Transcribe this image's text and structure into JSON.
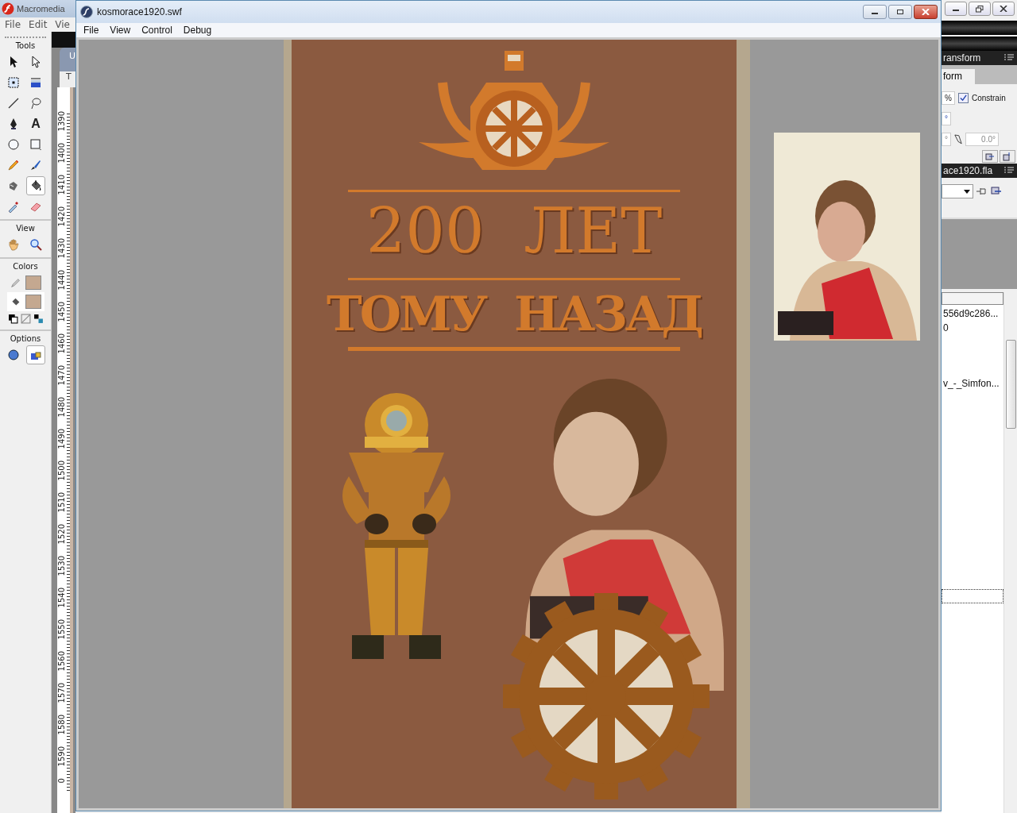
{
  "ide": {
    "title": "Macromedia",
    "menu": [
      "File",
      "Edit",
      "Vie"
    ],
    "sections": {
      "tools": "Tools",
      "view": "View",
      "colors": "Colors",
      "options": "Options"
    },
    "tools": [
      {
        "kind": "arrow",
        "selected": false
      },
      {
        "kind": "subselect",
        "selected": false
      },
      {
        "kind": "transform",
        "selected": false
      },
      {
        "kind": "gradient",
        "selected": false
      },
      {
        "kind": "line",
        "selected": false
      },
      {
        "kind": "lasso",
        "selected": false
      },
      {
        "kind": "pen",
        "selected": false
      },
      {
        "kind": "text",
        "glyph": "A",
        "selected": false
      },
      {
        "kind": "oval",
        "selected": false
      },
      {
        "kind": "rect",
        "selected": false
      },
      {
        "kind": "pencil",
        "selected": false
      },
      {
        "kind": "brush",
        "selected": false
      },
      {
        "kind": "ink",
        "selected": false
      },
      {
        "kind": "bucket",
        "selected": true
      },
      {
        "kind": "dropper",
        "selected": false
      },
      {
        "kind": "eraser",
        "selected": false
      }
    ],
    "tab_fragments": [
      "U",
      "T"
    ],
    "ruler": [
      "1390",
      "1400",
      "1410",
      "1420",
      "1430",
      "1440",
      "1450",
      "1460",
      "1470",
      "1480",
      "1490",
      "1500",
      "1510",
      "1520",
      "1530",
      "1540",
      "1550",
      "1560",
      "1570",
      "1580",
      "1590",
      "0"
    ]
  },
  "player": {
    "title": "kosmorace1920.swf",
    "menu": [
      "File",
      "View",
      "Control",
      "Debug"
    ],
    "poster": {
      "line1": "200  ЛЕТ",
      "line2": "ТОМУ  НАЗАД"
    }
  },
  "panels": {
    "transform_title": "ransform",
    "transform_tab": "form",
    "percent": "%",
    "constrain": {
      "label": "Constrain",
      "checked": true
    },
    "fields": [
      "°",
      "°"
    ],
    "rotation": "0.0°",
    "library_title": "ace1920.fla",
    "library_items": [
      "556d9c286...",
      "0",
      "v_-_Simfon..."
    ]
  }
}
